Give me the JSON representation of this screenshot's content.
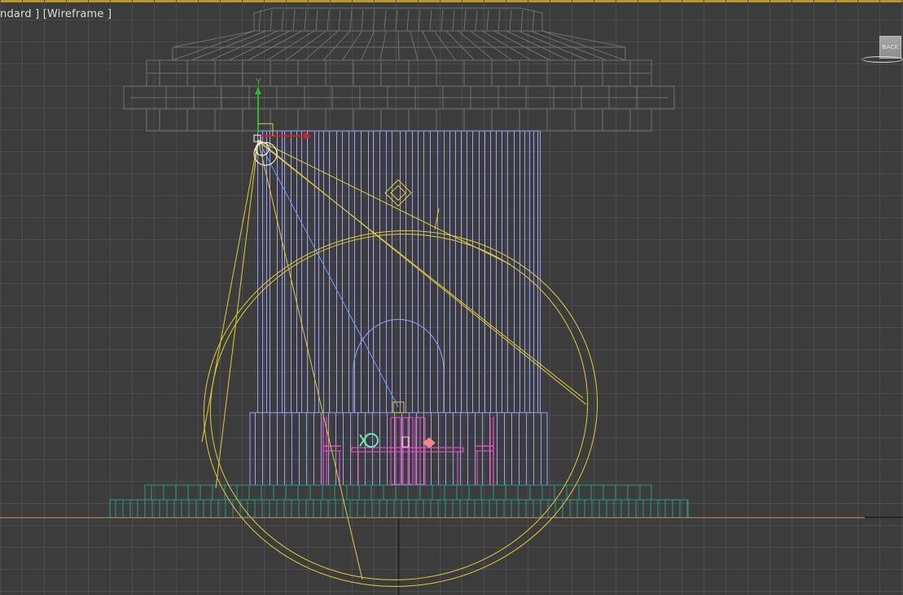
{
  "viewport": {
    "label": "ndard ] [Wireframe ]",
    "background": "#3c3c3c",
    "grid_color": "#4c4c4c",
    "grid_major_color": "#1e1e1e"
  },
  "viewcube": {
    "face_label": "BACK"
  },
  "axis_gizmo": {
    "y_label": "Y",
    "y_color": "#2fb52f",
    "x_color": "#d21e1e"
  },
  "scene_colors": {
    "ceiling": "#707070",
    "curtain": "#9da0ff",
    "light": "#e1cc3c",
    "light_dir": "#6aa0ff",
    "furniture": "#ff4fd0",
    "floor": "#1f9e85",
    "ground": "#c8965a",
    "accent_green": "#6be8b0",
    "accent_salmon": "#f08a8a"
  }
}
